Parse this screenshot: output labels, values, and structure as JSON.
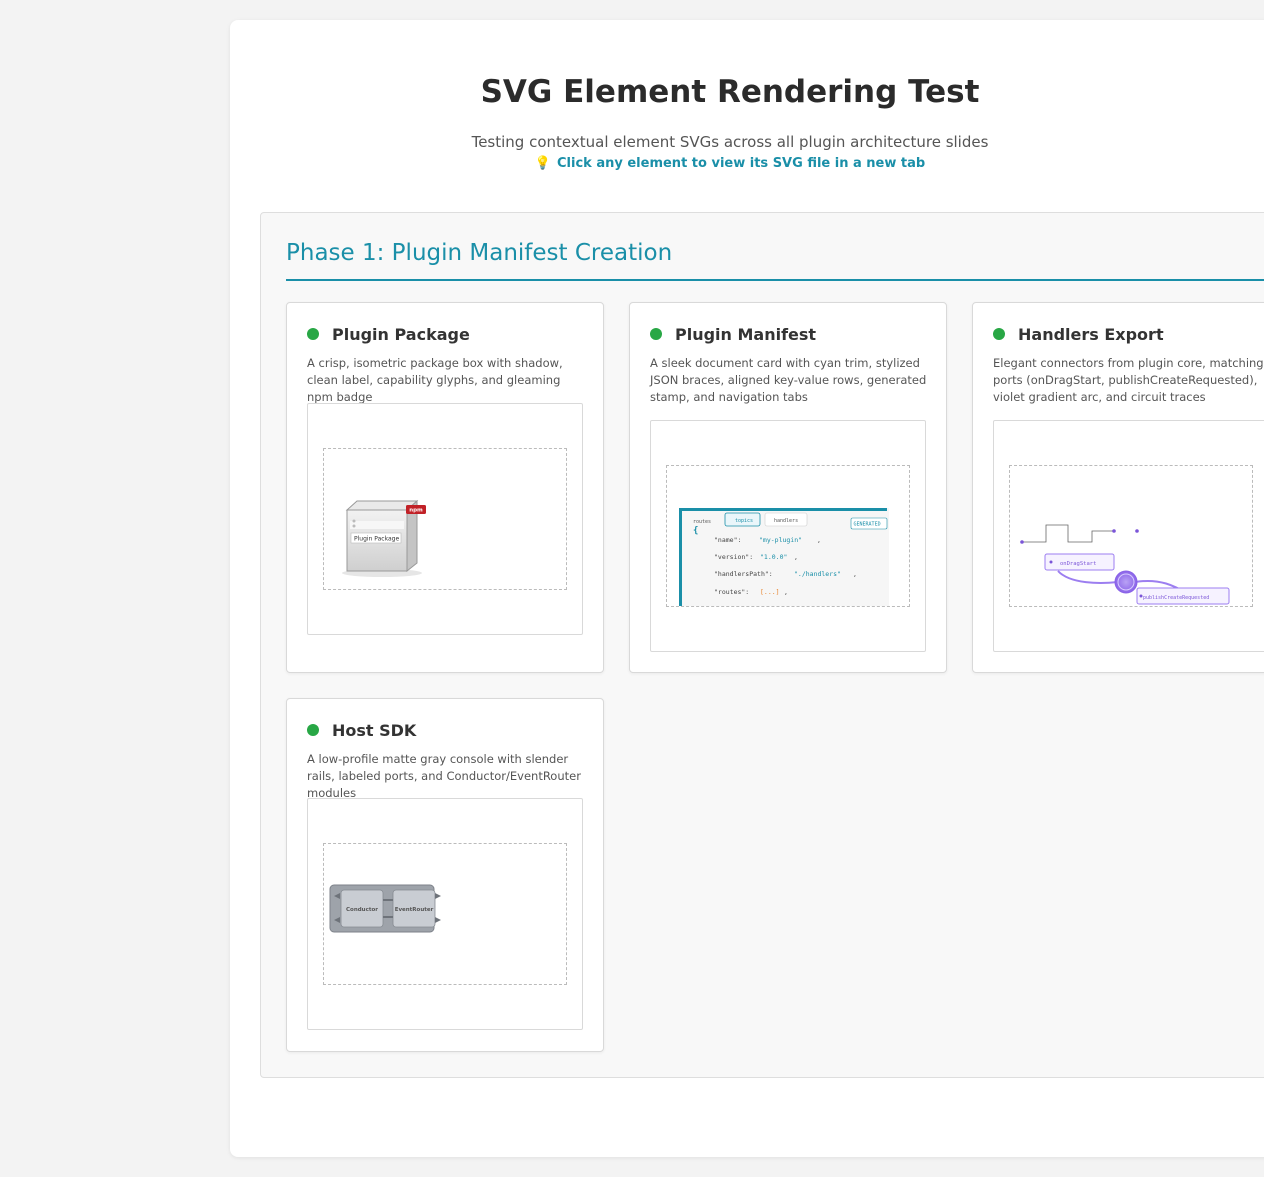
{
  "header": {
    "title": "SVG Element Rendering Test",
    "subtitle": "Testing contextual element SVGs across all plugin architecture slides",
    "hint_icon": "💡",
    "hint": "Click any element to view its SVG file in a new tab"
  },
  "phase": {
    "title": "Phase 1: Plugin Manifest Creation"
  },
  "cards": [
    {
      "name": "Plugin Package",
      "description": "A crisp, isometric package box with shadow, clean label, capability glyphs, and gleaming npm badge",
      "status_color": "#28a745",
      "svg": {
        "label": "Plugin Package",
        "badge": "npm"
      }
    },
    {
      "name": "Plugin Manifest",
      "description": "A sleek document card with cyan trim, stylized JSON braces, aligned key-value rows, generated stamp, and navigation tabs",
      "status_color": "#28a745",
      "svg": {
        "tabs": [
          "routes",
          "topics",
          "handlers"
        ],
        "stamp": "GENERATED",
        "brace": "{",
        "rows": [
          {
            "key": "\"name\":",
            "value": "\"my-plugin\"",
            "suffix": ","
          },
          {
            "key": "\"version\":",
            "value": "\"1.0.0\"",
            "suffix": ","
          },
          {
            "key": "\"handlersPath\":",
            "value": "\"./handlers\"",
            "suffix": ","
          },
          {
            "key": "\"routes\":",
            "value": "[...]",
            "suffix": ","
          }
        ]
      }
    },
    {
      "name": "Handlers Export",
      "description": "Elegant connectors from plugin core, matching ports (onDragStart, publishCreateRequested), violet gradient arc, and circuit traces",
      "status_color": "#28a745",
      "svg": {
        "port_a": "onDragStart",
        "port_b": "publishCreateRequested"
      }
    },
    {
      "name": "Host SDK",
      "description": "A low-profile matte gray console with slender rails, labeled ports, and Conductor/EventRouter modules",
      "status_color": "#28a745",
      "svg": {
        "module_a": "Conductor",
        "module_b": "EventRouter"
      }
    }
  ]
}
